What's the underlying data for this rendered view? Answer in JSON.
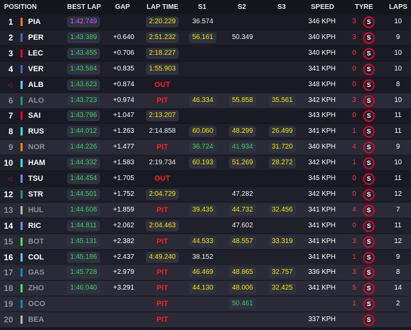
{
  "header": {
    "position": "POSITION",
    "best_lap": "BEST LAP",
    "gap": "GAP",
    "lap_time": "LAP TIME",
    "s1": "S1",
    "s2": "S2",
    "s3": "S3",
    "speed": "SPEED",
    "tyre": "TYRE",
    "laps": "LAPS"
  },
  "rows": [
    {
      "pos": "1",
      "code": "PIA",
      "team_color": "#ff8000",
      "best": "1:42.749",
      "best_color": "purple",
      "gap": "",
      "lap": "2:20.229",
      "lap_color": "yellow",
      "lap_type": "pill",
      "s1": "36.574",
      "s1c": "white",
      "s2": "",
      "s2c": "",
      "s3": "",
      "s3c": "",
      "speed": "346 KPH",
      "stint": "3",
      "laps": "10",
      "bg": "odd"
    },
    {
      "pos": "2",
      "code": "PER",
      "team_color": "#3671c6",
      "best": "1:43.389",
      "best_color": "green",
      "gap": "+0.640",
      "lap": "2:51.232",
      "lap_color": "yellow",
      "lap_type": "pill",
      "s1": "56.161",
      "s1c": "yellow",
      "s2": "50.349",
      "s2c": "white",
      "s3": "",
      "s3c": "",
      "speed": "340 KPH",
      "stint": "3",
      "laps": "9",
      "bg": "even"
    },
    {
      "pos": "3",
      "code": "LEC",
      "team_color": "#e8002d",
      "best": "1:43.455",
      "best_color": "green",
      "gap": "+0.706",
      "lap": "2:18.227",
      "lap_color": "yellow",
      "lap_type": "pill",
      "s1": "",
      "s1c": "",
      "s2": "",
      "s2c": "",
      "s3": "",
      "s3c": "",
      "speed": "340 KPH",
      "stint": "0",
      "laps": "10",
      "bg": "odd"
    },
    {
      "pos": "4",
      "code": "VER",
      "team_color": "#3671c6",
      "best": "1:43.584",
      "best_color": "green",
      "gap": "+0.835",
      "lap": "1:55.903",
      "lap_color": "yellow",
      "lap_type": "pill",
      "s1": "",
      "s1c": "",
      "s2": "",
      "s2c": "",
      "s3": "",
      "s3c": "",
      "speed": "341 KPH",
      "stint": "0",
      "laps": "10",
      "bg": "even"
    },
    {
      "pos": "◁",
      "code": "ALB",
      "team_color": "#64c4ff",
      "best": "1:43.623",
      "best_color": "green",
      "gap": "+0.874",
      "lap": "OUT",
      "lap_color": "red",
      "lap_type": "status",
      "s1": "",
      "s1c": "",
      "s2": "",
      "s2c": "",
      "s3": "",
      "s3c": "",
      "speed": "348 KPH",
      "stint": "0",
      "laps": "8",
      "bg": "odd",
      "arrow": true
    },
    {
      "pos": "6",
      "code": "ALO",
      "team_color": "#229971",
      "best": "1:43.723",
      "best_color": "green",
      "gap": "+0.974",
      "lap": "PIT",
      "lap_color": "red",
      "lap_type": "status",
      "s1": "46.334",
      "s1c": "yellow",
      "s2": "55.858",
      "s2c": "yellow",
      "s3": "35.561",
      "s3c": "yellow",
      "speed": "342 KPH",
      "stint": "3",
      "laps": "10",
      "bg": "hl",
      "dim": true
    },
    {
      "pos": "7",
      "code": "SAI",
      "team_color": "#e8002d",
      "best": "1:43.796",
      "best_color": "green",
      "gap": "+1.047",
      "lap": "2:13.207",
      "lap_color": "yellow",
      "lap_type": "pill",
      "s1": "",
      "s1c": "",
      "s2": "",
      "s2c": "",
      "s3": "",
      "s3c": "",
      "speed": "343 KPH",
      "stint": "0",
      "laps": "11",
      "bg": "odd"
    },
    {
      "pos": "8",
      "code": "RUS",
      "team_color": "#27f4d2",
      "best": "1:44.012",
      "best_color": "green",
      "gap": "+1.263",
      "lap": "2:14.858",
      "lap_color": "white",
      "lap_type": "text",
      "s1": "60.060",
      "s1c": "yellow",
      "s2": "48.299",
      "s2c": "yellow",
      "s3": "26.499",
      "s3c": "yellow",
      "speed": "341 KPH",
      "stint": "1",
      "laps": "11",
      "bg": "even"
    },
    {
      "pos": "9",
      "code": "NOR",
      "team_color": "#ff8000",
      "best": "1:44.226",
      "best_color": "green",
      "gap": "+1.477",
      "lap": "PIT",
      "lap_color": "red",
      "lap_type": "status",
      "s1": "36.724",
      "s1c": "green",
      "s2": "41.934",
      "s2c": "green",
      "s3": "31.720",
      "s3c": "yellow",
      "speed": "340 KPH",
      "stint": "4",
      "laps": "9",
      "bg": "hl",
      "dim": true
    },
    {
      "pos": "10",
      "code": "HAM",
      "team_color": "#27f4d2",
      "best": "1:44.332",
      "best_color": "green",
      "gap": "+1.583",
      "lap": "2:19.734",
      "lap_color": "white",
      "lap_type": "text",
      "s1": "60.193",
      "s1c": "yellow",
      "s2": "51.269",
      "s2c": "yellow",
      "s3": "28.272",
      "s3c": "yellow",
      "speed": "342 KPH",
      "stint": "1",
      "laps": "10",
      "bg": "even"
    },
    {
      "pos": "◁",
      "code": "TSU",
      "team_color": "#6692ff",
      "best": "1:44.454",
      "best_color": "green",
      "gap": "+1.705",
      "lap": "OUT",
      "lap_color": "red",
      "lap_type": "status",
      "s1": "",
      "s1c": "",
      "s2": "",
      "s2c": "",
      "s3": "",
      "s3c": "",
      "speed": "345 KPH",
      "stint": "0",
      "laps": "11",
      "bg": "odd",
      "arrow": true
    },
    {
      "pos": "12",
      "code": "STR",
      "team_color": "#229971",
      "best": "1:44.501",
      "best_color": "green",
      "gap": "+1.752",
      "lap": "2:04.729",
      "lap_color": "yellow",
      "lap_type": "pill",
      "s1": "",
      "s1c": "",
      "s2": "47.282",
      "s2c": "white",
      "s3": "",
      "s3c": "",
      "speed": "342 KPH",
      "stint": "0",
      "laps": "12",
      "bg": "even"
    },
    {
      "pos": "13",
      "code": "HUL",
      "team_color": "#b6babd",
      "best": "1:44.608",
      "best_color": "green",
      "gap": "+1.859",
      "lap": "PIT",
      "lap_color": "red",
      "lap_type": "status",
      "s1": "39.435",
      "s1c": "yellow",
      "s2": "44.732",
      "s2c": "yellow",
      "s3": "32.456",
      "s3c": "yellow",
      "speed": "341 KPH",
      "stint": "4",
      "laps": "7",
      "bg": "hl",
      "dim": true
    },
    {
      "pos": "14",
      "code": "RIC",
      "team_color": "#6692ff",
      "best": "1:44.811",
      "best_color": "green",
      "gap": "+2.062",
      "lap": "2:04.463",
      "lap_color": "yellow",
      "lap_type": "pill",
      "s1": "",
      "s1c": "",
      "s2": "47.602",
      "s2c": "white",
      "s3": "",
      "s3c": "",
      "speed": "341 KPH",
      "stint": "0",
      "laps": "11",
      "bg": "even"
    },
    {
      "pos": "15",
      "code": "BOT",
      "team_color": "#52e252",
      "best": "1:45.131",
      "best_color": "green",
      "gap": "+2.382",
      "lap": "PIT",
      "lap_color": "red",
      "lap_type": "status",
      "s1": "44.533",
      "s1c": "yellow",
      "s2": "48.557",
      "s2c": "yellow",
      "s3": "33.319",
      "s3c": "yellow",
      "speed": "341 KPH",
      "stint": "3",
      "laps": "12",
      "bg": "hl",
      "dim": true
    },
    {
      "pos": "16",
      "code": "COL",
      "team_color": "#64c4ff",
      "best": "1:45.186",
      "best_color": "green",
      "gap": "+2.437",
      "lap": "4:49.240",
      "lap_color": "yellow",
      "lap_type": "pill",
      "s1": "38.152",
      "s1c": "white",
      "s2": "",
      "s2c": "",
      "s3": "",
      "s3c": "",
      "speed": "341 KPH",
      "stint": "1",
      "laps": "9",
      "bg": "even"
    },
    {
      "pos": "17",
      "code": "GAS",
      "team_color": "#0093cc",
      "best": "1:45.728",
      "best_color": "green",
      "gap": "+2.979",
      "lap": "PIT",
      "lap_color": "red",
      "lap_type": "status",
      "s1": "46.469",
      "s1c": "yellow",
      "s2": "48.865",
      "s2c": "yellow",
      "s3": "32.757",
      "s3c": "yellow",
      "speed": "336 KPH",
      "stint": "3",
      "laps": "8",
      "bg": "hl",
      "dim": true
    },
    {
      "pos": "18",
      "code": "ZHO",
      "team_color": "#52e252",
      "best": "1:46.040",
      "best_color": "green",
      "gap": "+3.291",
      "lap": "PIT",
      "lap_color": "red",
      "lap_type": "status",
      "s1": "44.130",
      "s1c": "yellow",
      "s2": "48.006",
      "s2c": "yellow",
      "s3": "32.425",
      "s3c": "yellow",
      "speed": "341 KPH",
      "stint": "5",
      "laps": "14",
      "bg": "hl",
      "dim": true
    },
    {
      "pos": "19",
      "code": "OCO",
      "team_color": "#0093cc",
      "best": "",
      "best_color": "",
      "gap": "",
      "lap": "PIT",
      "lap_color": "red",
      "lap_type": "status",
      "s1": "",
      "s1c": "",
      "s2": "50.461",
      "s2c": "green",
      "s3": "",
      "s3c": "",
      "speed": "",
      "stint": "1",
      "laps": "2",
      "bg": "hl",
      "dim": true
    },
    {
      "pos": "20",
      "code": "BEA",
      "team_color": "#b6babd",
      "best": "",
      "best_color": "",
      "gap": "",
      "lap": "PIT",
      "lap_color": "red",
      "lap_type": "status",
      "s1": "",
      "s1c": "",
      "s2": "",
      "s2c": "",
      "s3": "",
      "s3c": "",
      "speed": "337 KPH",
      "stint": "",
      "laps": "",
      "bg": "hl",
      "dim": true
    }
  ],
  "tyre_compound": "S",
  "colors": {
    "purple": "#c958ff",
    "green": "#3cd05a",
    "yellow": "#f5e600",
    "red": "#ff1e1e",
    "tyre_soft": "#e8002d"
  }
}
